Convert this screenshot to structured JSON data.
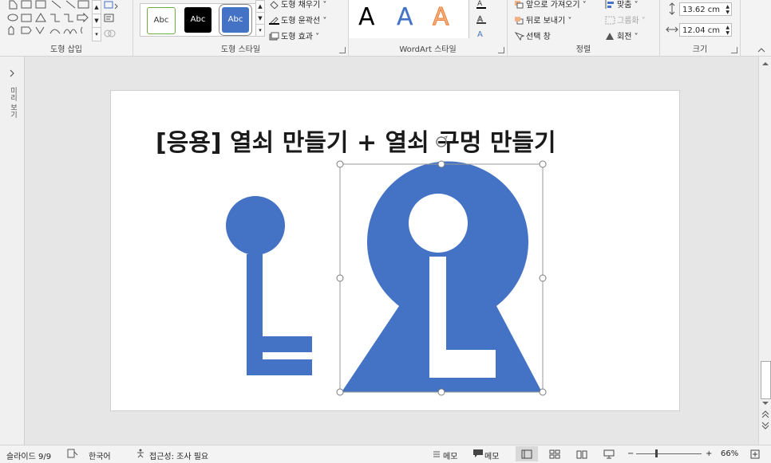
{
  "ribbon": {
    "groups": {
      "insert_shapes": "도형 삽입",
      "shape_styles": "도형 스타일",
      "wordart_styles": "WordArt 스타일",
      "arrange": "정렬",
      "size": "크기"
    },
    "style_samples": [
      "Abc",
      "Abc",
      "Abc"
    ],
    "shape_fill": "도형 채우기",
    "shape_outline": "도형 윤곽선",
    "shape_effects": "도형 효과",
    "wordart_letters": [
      "A",
      "A",
      "A"
    ],
    "bring_forward": "앞으로 가져오기",
    "send_backward": "뒤로 보내기",
    "selection_pane": "선택 창",
    "align": "맞춤",
    "group": "그룹화",
    "rotate": "회전",
    "height": "13.62 cm",
    "width": "12.04 cm"
  },
  "left_pane": {
    "label": "미리 보기"
  },
  "slide": {
    "title": "[응용] 열쇠 만들기 + 열쇠 구멍 만들기"
  },
  "status": {
    "slide_count": "슬라이드 9/9",
    "language": "한국어",
    "accessibility": "접근성: 조사 필요",
    "notes": "메모",
    "comments": "메모",
    "zoom": "66%"
  },
  "colors": {
    "accent": "#4472c4",
    "selected_style": "#4472c4"
  }
}
